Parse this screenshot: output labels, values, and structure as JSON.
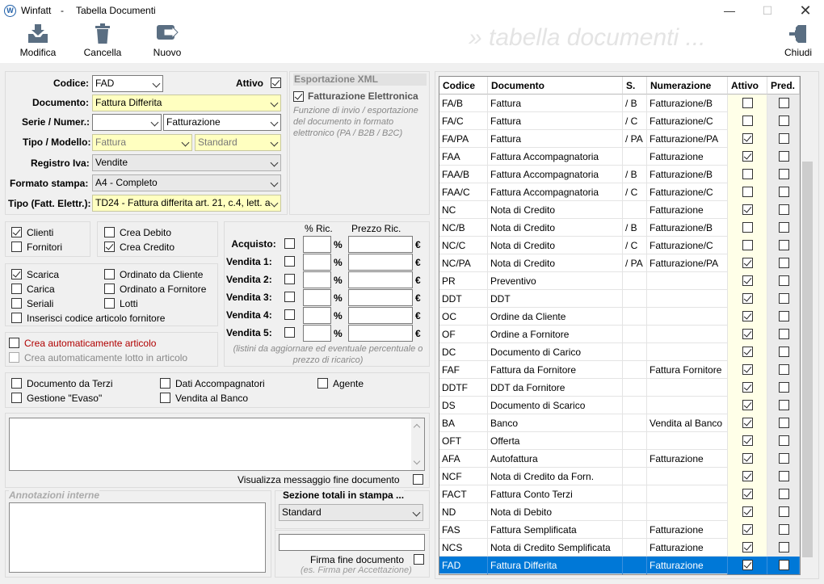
{
  "window": {
    "app_name": "Winfatt",
    "sep": "-",
    "title": "Tabella Documenti"
  },
  "toolbar": {
    "modifica": "Modifica",
    "cancella": "Cancella",
    "nuovo": "Nuovo",
    "chiudi": "Chiudi",
    "banner": "» tabella documenti ..."
  },
  "form": {
    "codice_label": "Codice:",
    "codice_value": "FAD",
    "attivo_label": "Attivo",
    "attivo_checked": true,
    "documento_label": "Documento:",
    "documento_value": "Fattura Differita",
    "serie_label": "Serie / Numer.:",
    "serie_value": "",
    "numer_value": "Fatturazione",
    "tipo_label": "Tipo / Modello:",
    "tipo_value": "Fattura",
    "modello_value": "Standard",
    "registro_label": "Registro Iva:",
    "registro_value": "Vendite",
    "formato_label": "Formato stampa:",
    "formato_value": "A4 - Completo",
    "tipofe_label": "Tipo (Fatt. Elettr.):",
    "tipofe_value": "TD24 - Fattura differita art. 21, c.4, lett. a"
  },
  "xml": {
    "title": "Esportazione XML",
    "fe_label": "Fatturazione Elettronica",
    "fe_checked": true,
    "note": "Funzione di invio / esportazione del documento in formato elettronico (PA / B2B / B2C)"
  },
  "options1": {
    "clienti": "Clienti",
    "fornitori": "Fornitori",
    "crea_debito": "Crea Debito",
    "crea_credito": "Crea Credito"
  },
  "options2": {
    "scarica": "Scarica",
    "carica": "Carica",
    "seriali": "Seriali",
    "ordinato_cliente": "Ordinato da Cliente",
    "ordinato_fornitore": "Ordinato a Fornitore",
    "lotti": "Lotti",
    "inserisci": "Inserisci codice articolo fornitore"
  },
  "options3": {
    "crea_articolo": "Crea automaticamente articolo",
    "crea_lotto": "Crea automaticamente lotto in articolo"
  },
  "ricarichi": {
    "pct_header": "% Ric.",
    "prezzo_header": "Prezzo Ric.",
    "pct": "%",
    "eur": "€",
    "rows": [
      "Acquisto:",
      "Vendita 1:",
      "Vendita 2:",
      "Vendita 3:",
      "Vendita 4:",
      "Vendita 5:"
    ],
    "note": "(listini da aggiornare ed eventuale percentuale o prezzo di ricarico)"
  },
  "options4": {
    "terzi": "Documento da Terzi",
    "evaso": "Gestione \"Evaso\"",
    "accompagnatori": "Dati Accompagnatori",
    "banco": "Vendita al Banco",
    "agente": "Agente"
  },
  "messaggio": {
    "label": "Visualizza messaggio fine documento"
  },
  "annotazioni": {
    "label": "Annotazioni interne"
  },
  "sezione": {
    "label": "Sezione totali in stampa ...",
    "value": "Standard"
  },
  "firma": {
    "label": "Firma fine documento",
    "note": "(es. Firma per Accettazione)"
  },
  "grid": {
    "headers": [
      "Codice",
      "Documento",
      "S.",
      "Numerazione",
      "Attivo",
      "Pred."
    ],
    "rows": [
      {
        "code": "FA/B",
        "doc": "Fattura",
        "s": "/ B",
        "num": "Fatturazione/B",
        "att": false,
        "pred": false
      },
      {
        "code": "FA/C",
        "doc": "Fattura",
        "s": "/ C",
        "num": "Fatturazione/C",
        "att": false,
        "pred": false
      },
      {
        "code": "FA/PA",
        "doc": "Fattura",
        "s": "/ PA",
        "num": "Fatturazione/PA",
        "att": true,
        "pred": false
      },
      {
        "code": "FAA",
        "doc": "Fattura Accompagnatoria",
        "s": "",
        "num": "Fatturazione",
        "att": true,
        "pred": false
      },
      {
        "code": "FAA/B",
        "doc": "Fattura Accompagnatoria",
        "s": "/ B",
        "num": "Fatturazione/B",
        "att": false,
        "pred": false
      },
      {
        "code": "FAA/C",
        "doc": "Fattura Accompagnatoria",
        "s": "/ C",
        "num": "Fatturazione/C",
        "att": false,
        "pred": false
      },
      {
        "code": "NC",
        "doc": "Nota di Credito",
        "s": "",
        "num": "Fatturazione",
        "att": true,
        "pred": false
      },
      {
        "code": "NC/B",
        "doc": "Nota di Credito",
        "s": "/ B",
        "num": "Fatturazione/B",
        "att": false,
        "pred": false
      },
      {
        "code": "NC/C",
        "doc": "Nota di Credito",
        "s": "/ C",
        "num": "Fatturazione/C",
        "att": false,
        "pred": false
      },
      {
        "code": "NC/PA",
        "doc": "Nota di Credito",
        "s": "/ PA",
        "num": "Fatturazione/PA",
        "att": true,
        "pred": false
      },
      {
        "code": "PR",
        "doc": "Preventivo",
        "s": "",
        "num": "",
        "att": true,
        "pred": false
      },
      {
        "code": "DDT",
        "doc": "DDT",
        "s": "",
        "num": "",
        "att": true,
        "pred": false
      },
      {
        "code": "OC",
        "doc": "Ordine da Cliente",
        "s": "",
        "num": "",
        "att": true,
        "pred": false
      },
      {
        "code": "OF",
        "doc": "Ordine a Fornitore",
        "s": "",
        "num": "",
        "att": true,
        "pred": false
      },
      {
        "code": "DC",
        "doc": "Documento di Carico",
        "s": "",
        "num": "",
        "att": true,
        "pred": false
      },
      {
        "code": "FAF",
        "doc": "Fattura da Fornitore",
        "s": "",
        "num": "Fattura Fornitore",
        "att": true,
        "pred": false
      },
      {
        "code": "DDTF",
        "doc": "DDT da Fornitore",
        "s": "",
        "num": "",
        "att": true,
        "pred": false
      },
      {
        "code": "DS",
        "doc": "Documento di Scarico",
        "s": "",
        "num": "",
        "att": true,
        "pred": false
      },
      {
        "code": "BA",
        "doc": "Banco",
        "s": "",
        "num": "Vendita al Banco",
        "att": true,
        "pred": false
      },
      {
        "code": "OFT",
        "doc": "Offerta",
        "s": "",
        "num": "",
        "att": true,
        "pred": false
      },
      {
        "code": "AFA",
        "doc": "Autofattura",
        "s": "",
        "num": "Fatturazione",
        "att": true,
        "pred": false
      },
      {
        "code": "NCF",
        "doc": "Nota di Credito da Forn.",
        "s": "",
        "num": "",
        "att": true,
        "pred": false
      },
      {
        "code": "FACT",
        "doc": "Fattura Conto Terzi",
        "s": "",
        "num": "",
        "att": true,
        "pred": false
      },
      {
        "code": "ND",
        "doc": "Nota di Debito",
        "s": "",
        "num": "",
        "att": true,
        "pred": false
      },
      {
        "code": "FAS",
        "doc": "Fattura Semplificata",
        "s": "",
        "num": "Fatturazione",
        "att": true,
        "pred": false
      },
      {
        "code": "NCS",
        "doc": "Nota di Credito Semplificata",
        "s": "",
        "num": "Fatturazione",
        "att": true,
        "pred": false
      },
      {
        "code": "FAD",
        "doc": "Fattura Differita",
        "s": "",
        "num": "Fatturazione",
        "att": true,
        "pred": false,
        "selected": true
      }
    ]
  }
}
